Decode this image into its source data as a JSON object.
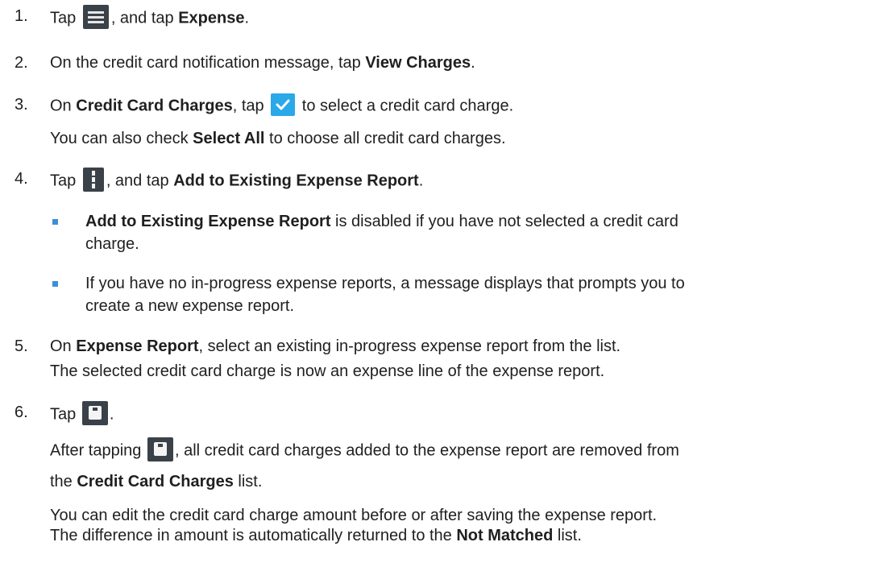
{
  "steps": [
    {
      "num": "1.",
      "a": "Tap ",
      "b": ", and tap ",
      "bold": "Expense",
      "c": "."
    },
    {
      "num": "2.",
      "a": "On the credit card notification message, tap ",
      "bold": "View Charges",
      "b": "."
    },
    {
      "num": "3.",
      "a": "On ",
      "bold": "Credit Card Charges",
      "b": ", tap ",
      "c": " to select a credit card charge.",
      "sub_a": "You can also check ",
      "sub_bold": "Select All",
      "sub_b": " to choose all credit card charges."
    },
    {
      "num": "4.",
      "a": "Tap ",
      "b": ", and tap ",
      "bold": "Add to Existing Expense Report",
      "c": "."
    },
    {
      "num": "5.",
      "a": "On ",
      "bold": "Expense Report",
      "b": ", select an existing in-progress expense report from the list.",
      "sub": "The selected credit card charge is now an expense line of the expense report."
    },
    {
      "num": "6.",
      "a": "Tap ",
      "b": ".",
      "sub1_a": "After tapping ",
      "sub1_b": ", all credit card charges added to the expense report are removed from",
      "sub2_a": "the ",
      "sub2_bold": "Credit Card Charges",
      "sub2_b": " list.",
      "sub3": "You can edit the credit card charge amount before or after saving the expense report.",
      "sub4_a": "The difference in amount is automatically returned to the ",
      "sub4_bold": "Not Matched",
      "sub4_b": " list."
    }
  ],
  "bullets": [
    {
      "bold": "Add to Existing Expense Report",
      "text": " is disabled if you have not selected a credit card",
      "cont": "charge."
    },
    {
      "text1": "If you have no in-progress expense reports, a message displays that prompts you to",
      "text2": "create a new expense report."
    }
  ],
  "icons": {
    "menu": "hamburger-menu-icon",
    "check": "checkmark-icon",
    "more": "vertical-more-icon",
    "save": "save-icon"
  }
}
